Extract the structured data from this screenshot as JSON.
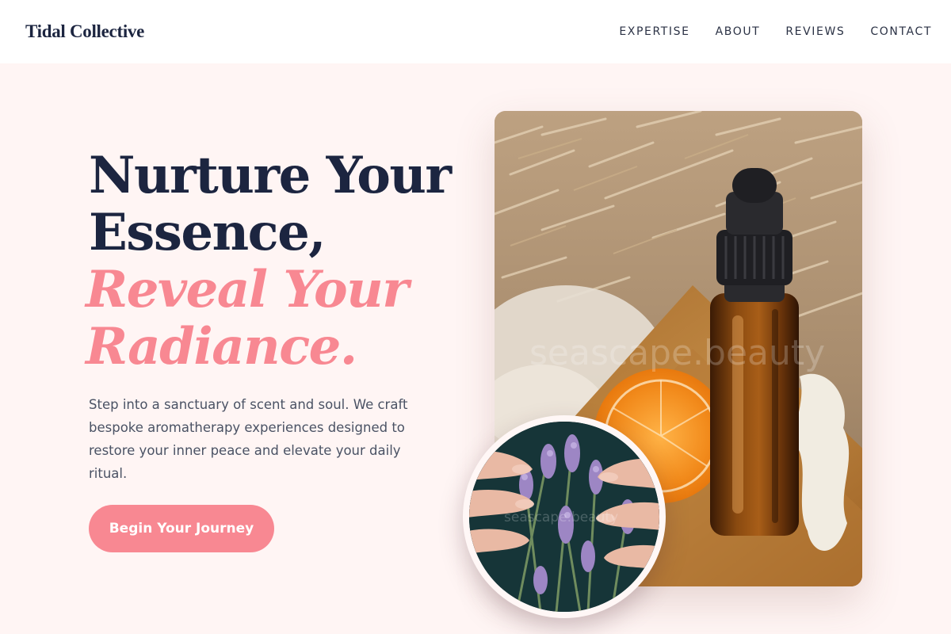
{
  "brand": {
    "name": "Tidal Collective"
  },
  "nav": {
    "items": [
      "EXPERTISE",
      "ABOUT",
      "REVIEWS",
      "CONTACT"
    ]
  },
  "hero": {
    "headline_line1": "Nurture Your",
    "headline_line2": "Essence,",
    "accent_line1": "Reveal Your",
    "accent_line2": "Radiance.",
    "description": "Step into a sanctuary of scent and soul. We craft bespoke aromatherapy experiences designed to restore your inner peace and elevate your daily ritual.",
    "cta_label": "Begin Your Journey"
  },
  "images": {
    "main": {
      "subject": "amber dropper bottle with orange slice and dried grass",
      "watermark": "seascape.beauty"
    },
    "circle": {
      "subject": "hands holding lavender sprigs",
      "watermark": "seascape.beauty"
    }
  },
  "colors": {
    "accent": "#f88892",
    "navy": "#1c2540",
    "background": "#fff5f4",
    "text": "#4a5264"
  }
}
